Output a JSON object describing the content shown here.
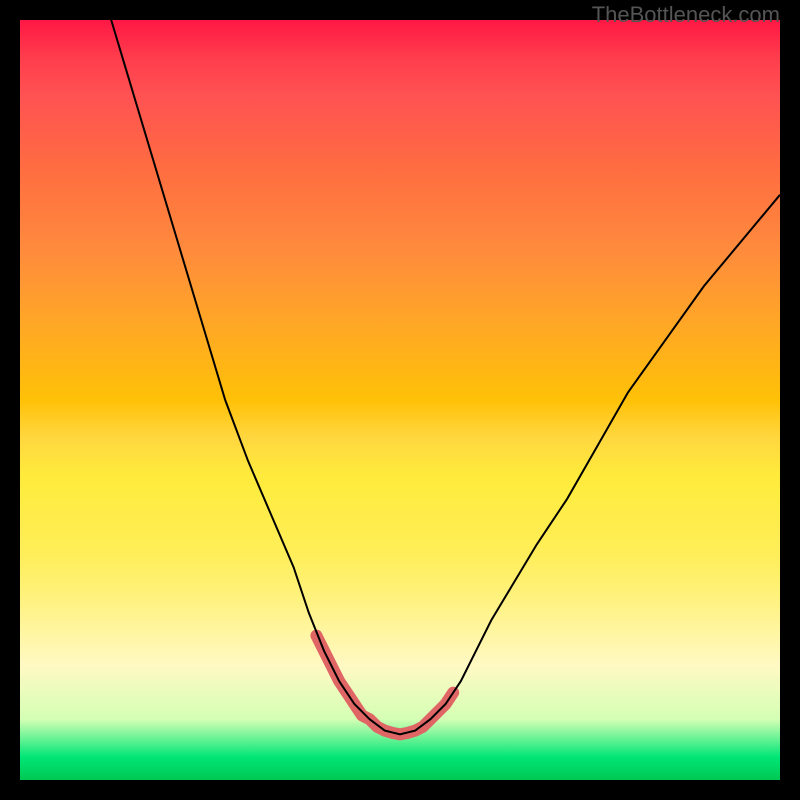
{
  "watermark": "TheBottleneck.com",
  "chart_data": {
    "type": "line",
    "title": "",
    "xlabel": "",
    "ylabel": "",
    "xlim": [
      0,
      100
    ],
    "ylim": [
      0,
      100
    ],
    "series": [
      {
        "name": "bottleneck-curve",
        "color": "#000000",
        "x": [
          12,
          15,
          18,
          21,
          24,
          27,
          30,
          33,
          36,
          38,
          40,
          42,
          44,
          46,
          48,
          50,
          52,
          54,
          56,
          58,
          60,
          62,
          65,
          68,
          72,
          76,
          80,
          85,
          90,
          95,
          100
        ],
        "y": [
          100,
          90,
          80,
          70,
          60,
          50,
          42,
          35,
          28,
          22,
          17,
          13,
          10,
          8,
          6.5,
          6,
          6.5,
          8,
          10,
          13,
          17,
          21,
          26,
          31,
          37,
          44,
          51,
          58,
          65,
          71,
          77
        ]
      }
    ],
    "highlight": {
      "name": "valley-highlight",
      "color": "#e06666",
      "stroke_width": 12,
      "x": [
        39,
        40,
        41,
        42,
        43,
        44,
        45,
        46,
        47,
        48,
        49,
        50,
        51,
        52,
        53,
        54,
        55,
        56,
        57
      ],
      "y": [
        19,
        17,
        15,
        13,
        11.5,
        10,
        8.5,
        8,
        7,
        6.5,
        6.2,
        6,
        6.2,
        6.5,
        7,
        8,
        9,
        10,
        11.5
      ]
    },
    "gradient_bands": [
      {
        "color": "#ff1744",
        "position": 0
      },
      {
        "color": "#ff8a3d",
        "position": 30
      },
      {
        "color": "#ffeb3b",
        "position": 60
      },
      {
        "color": "#fff9c4",
        "position": 85
      },
      {
        "color": "#00E676",
        "position": 97
      }
    ]
  }
}
